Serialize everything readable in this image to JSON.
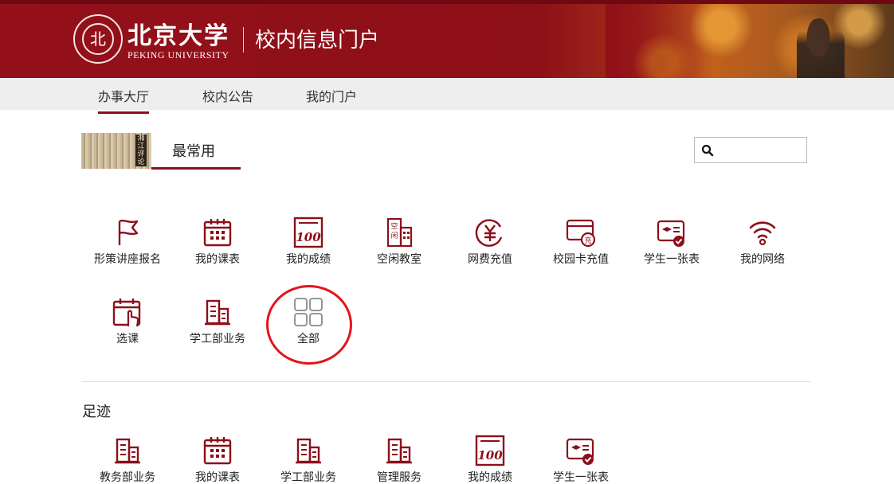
{
  "header": {
    "university_cn": "北京大学",
    "university_en": "PEKING UNIVERSITY",
    "portal_title": "校内信息门户",
    "seal_char": "北"
  },
  "nav": {
    "tabs": [
      "办事大厅",
      "校内公告",
      "我的门户"
    ],
    "active": "办事大厅"
  },
  "most_used": {
    "title": "最常用",
    "thumb_text": "湘江评论",
    "items": [
      {
        "label": "形策讲座报名",
        "icon": "flag-icon"
      },
      {
        "label": "我的课表",
        "icon": "calendar-icon"
      },
      {
        "label": "我的成绩",
        "icon": "score-100-icon"
      },
      {
        "label": "空闲教室",
        "icon": "building-room-icon"
      },
      {
        "label": "网费充值",
        "icon": "yuan-icon"
      },
      {
        "label": "校园卡充值",
        "icon": "card-recharge-icon"
      },
      {
        "label": "学生一张表",
        "icon": "student-card-icon"
      },
      {
        "label": "我的网络",
        "icon": "wifi-icon"
      },
      {
        "label": "选课",
        "icon": "calendar-hand-icon"
      },
      {
        "label": "学工部业务",
        "icon": "building-icon"
      },
      {
        "label": "全部",
        "icon": "grid-icon"
      }
    ]
  },
  "footprint": {
    "title": "足迹",
    "items": [
      {
        "label": "教务部业务",
        "icon": "building-icon"
      },
      {
        "label": "我的课表",
        "icon": "calendar-icon"
      },
      {
        "label": "学工部业务",
        "icon": "building-icon"
      },
      {
        "label": "管理服务",
        "icon": "building-icon"
      },
      {
        "label": "我的成绩",
        "icon": "score-100-icon"
      },
      {
        "label": "学生一张表",
        "icon": "student-card-icon"
      }
    ]
  },
  "search": {
    "placeholder": ""
  },
  "colors": {
    "brand": "#8c0f19",
    "highlight_circle": "#e3141c"
  }
}
